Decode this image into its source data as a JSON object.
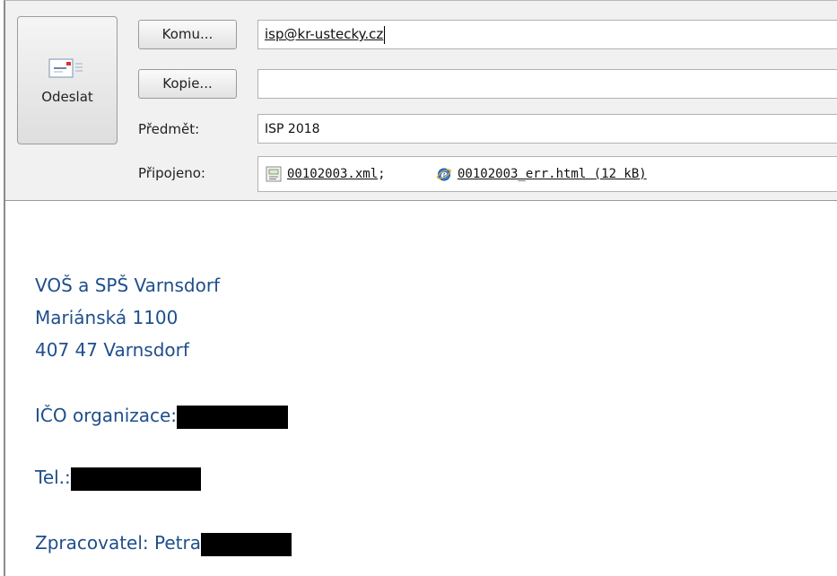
{
  "send": {
    "label": "Odeslat",
    "icon": "send-email-icon"
  },
  "to": {
    "button": "Komu...",
    "value": "isp@kr-ustecky.cz"
  },
  "cc": {
    "button": "Kopie...",
    "value": ""
  },
  "subject": {
    "label": "Předmět:",
    "value": "ISP 2018"
  },
  "attachments": {
    "label": "Připojeno:",
    "items": [
      {
        "name": "00102003.xml",
        "separator": ";",
        "icon": "xml-file-icon"
      },
      {
        "name": "00102003_err.html (12 kB)",
        "icon": "internet-explorer-icon"
      }
    ]
  },
  "body": {
    "lines": [
      "VOŠ a SPŠ Varnsdorf",
      "Mariánská 1100",
      "407 47 Varnsdorf"
    ],
    "ico_label": "IČO organizace:",
    "tel_label": "Tel.:",
    "author_label": "Zpracovatel: Petra"
  },
  "colors": {
    "body_text": "#1f4e8c",
    "header_bg": "#f1f1f1"
  }
}
